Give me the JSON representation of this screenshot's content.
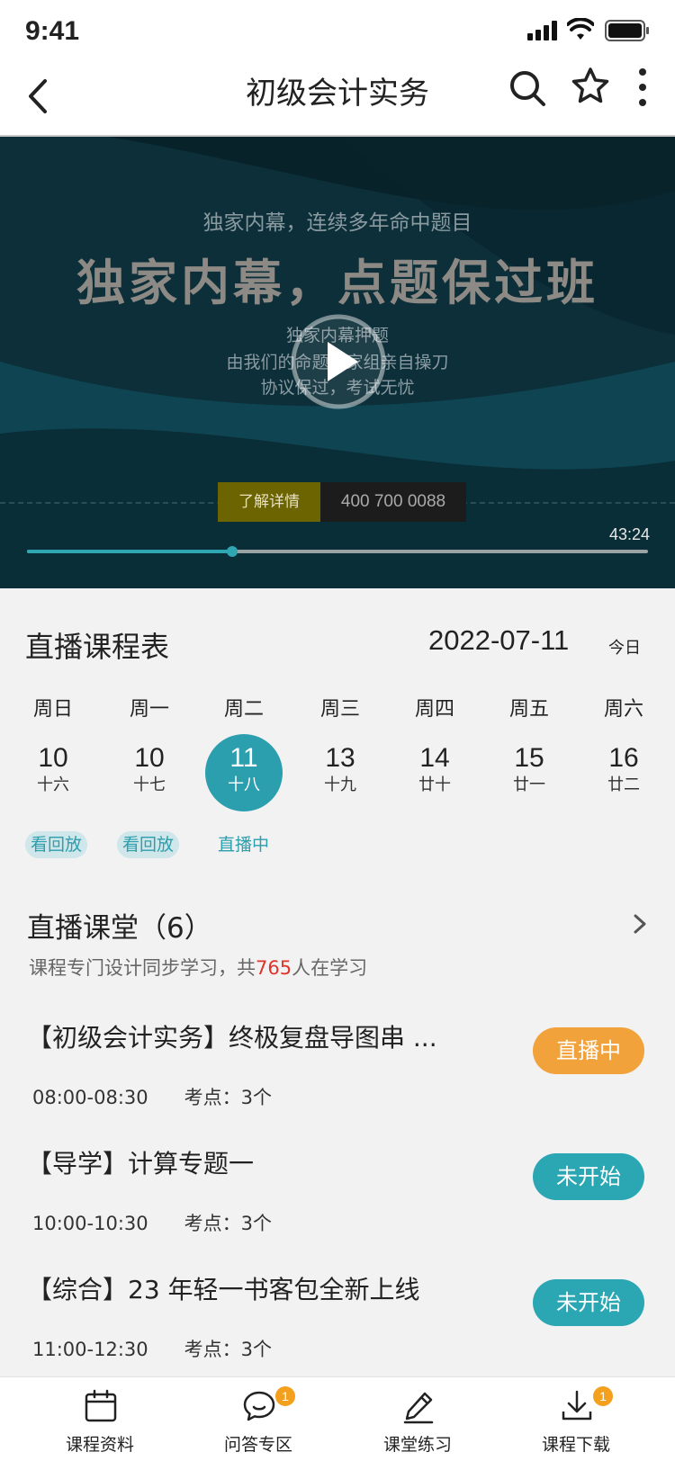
{
  "status_bar": {
    "time": "9:41",
    "icons": [
      "cellular-signal-icon",
      "wifi-icon",
      "battery-icon"
    ]
  },
  "nav": {
    "title": "初级会计实务",
    "icons": [
      "back-arrow-icon",
      "search-icon",
      "star-icon",
      "more-vertical-icon"
    ]
  },
  "video": {
    "subtitle": "独家内幕，连续多年命中题目",
    "headline": "独家内幕，点题保过班",
    "lines": [
      "独家内幕押题",
      "由我们的命题专家组亲自操刀",
      "协议保过，考试无忧"
    ],
    "detail_button": "了解详情",
    "phone": "400 700 0088",
    "duration": "43:24",
    "progress": 0.33,
    "accent_color": "#2fa7b2"
  },
  "schedule": {
    "title": "直播课程表",
    "date": "2022-07-11",
    "today_label": "今日",
    "days": [
      {
        "weekday": "周日",
        "day": "10",
        "lunar": "十六",
        "selected": false
      },
      {
        "weekday": "周一",
        "day": "10",
        "lunar": "十七",
        "selected": false
      },
      {
        "weekday": "周二",
        "day": "11",
        "lunar": "十八",
        "selected": true
      },
      {
        "weekday": "周三",
        "day": "13",
        "lunar": "十九",
        "selected": false
      },
      {
        "weekday": "周四",
        "day": "14",
        "lunar": "廿十",
        "selected": false
      },
      {
        "weekday": "周五",
        "day": "15",
        "lunar": "廿一",
        "selected": false
      },
      {
        "weekday": "周六",
        "day": "16",
        "lunar": "廿二",
        "selected": false
      }
    ],
    "tags": [
      "看回放",
      "看回放",
      "直播中"
    ],
    "selected_color": "#2b9fae"
  },
  "live_room": {
    "title": "直播课堂（6）",
    "subtitle_prefix": "课程专门设计同步学习，共",
    "learner_count": "765",
    "subtitle_suffix": "人在学习",
    "courses": [
      {
        "title": "【初级会计实务】终极复盘导图串 ...",
        "time": "08:00-08:30",
        "points": "考点：3个",
        "status": "直播中",
        "status_color": "#f2a23a"
      },
      {
        "title": "【导学】计算专题一",
        "time": "10:00-10:30",
        "points": "考点：3个",
        "status": "未开始",
        "status_color": "#2ba6b3"
      },
      {
        "title": "【综合】23 年轻一书客包全新上线",
        "time": "11:00-12:30",
        "points": "考点：3个",
        "status": "未开始",
        "status_color": "#2ba6b3"
      }
    ]
  },
  "tabbar": {
    "tabs": [
      {
        "label": "课程资料",
        "icon": "calendar-icon",
        "badge": ""
      },
      {
        "label": "问答专区",
        "icon": "chat-bubble-icon",
        "badge": "1"
      },
      {
        "label": "课堂练习",
        "icon": "pen-icon",
        "badge": ""
      },
      {
        "label": "课程下载",
        "icon": "download-icon",
        "badge": "1"
      }
    ],
    "badge_color": "#f2a01e"
  }
}
